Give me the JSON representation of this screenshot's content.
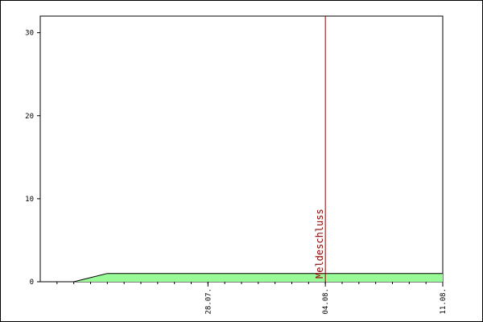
{
  "chart_data": {
    "type": "area",
    "title": "",
    "xlabel": "",
    "ylabel": "",
    "x": [
      "2025-07-20",
      "2025-07-22",
      "2025-08-11"
    ],
    "series": [
      {
        "values": [
          0,
          1,
          1
        ]
      }
    ],
    "xlim": [
      "2025-07-18",
      "2025-08-11"
    ],
    "ylim": [
      0,
      32
    ],
    "y_ticks": [
      0,
      10,
      20,
      30
    ],
    "y_tick_labels": [
      "0",
      "10",
      "20",
      "30"
    ],
    "x_ticks": [
      "2025-07-28",
      "2025-08-04",
      "2025-08-11"
    ],
    "x_tick_labels": [
      "28.07.",
      "04.08.",
      "11.08."
    ],
    "x_tick_rotation": "vertical",
    "grid": false,
    "legend": "none",
    "fill_color": "#98fb98",
    "line_color": "#000000",
    "vertical_markers": [
      {
        "x": "2025-08-04",
        "label": "Meldeschluss",
        "color": "#8b0000"
      }
    ]
  }
}
